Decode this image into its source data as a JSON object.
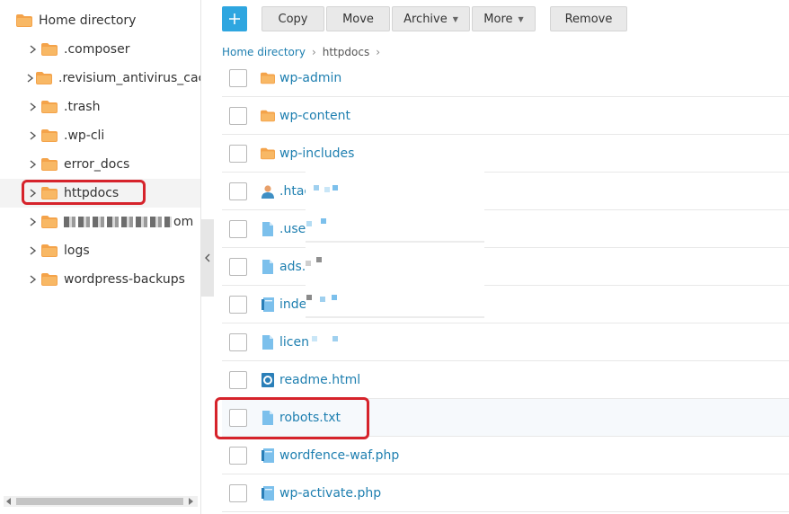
{
  "tree": {
    "root_label": "Home directory",
    "items": [
      {
        "label": ".composer"
      },
      {
        "label": ".revisium_antivirus_cach"
      },
      {
        "label": ".trash"
      },
      {
        "label": ".wp-cli"
      },
      {
        "label": "error_docs"
      },
      {
        "label": "httpdocs"
      },
      {
        "label": "om"
      },
      {
        "label": "logs"
      },
      {
        "label": "wordpress-backups"
      }
    ]
  },
  "toolbar": {
    "copy_label": "Copy",
    "move_label": "Move",
    "archive_label": "Archive",
    "more_label": "More",
    "remove_label": "Remove"
  },
  "breadcrumb": {
    "home": "Home directory",
    "current": "httpdocs"
  },
  "files": [
    {
      "name": "wp-admin",
      "icon": "folder-icon"
    },
    {
      "name": "wp-content",
      "icon": "folder-icon"
    },
    {
      "name": "wp-includes",
      "icon": "folder-icon"
    },
    {
      "name": ".htac",
      "icon": "user-file-icon"
    },
    {
      "name": ".use",
      "icon": "file-icon"
    },
    {
      "name": "ads.",
      "icon": "file-icon"
    },
    {
      "name": "inde",
      "icon": "php-file-icon"
    },
    {
      "name": "licen",
      "icon": "file-icon"
    },
    {
      "name": "readme.html",
      "icon": "html-file-icon"
    },
    {
      "name": "robots.txt",
      "icon": "file-icon"
    },
    {
      "name": "wordfence-waf.php",
      "icon": "php-file-icon"
    },
    {
      "name": "wp-activate.php",
      "icon": "php-file-icon"
    }
  ],
  "colors": {
    "accent": "#2ea6e0",
    "link": "#1e7fb0",
    "folder": "#f4a34a",
    "highlight": "#d6232b"
  }
}
